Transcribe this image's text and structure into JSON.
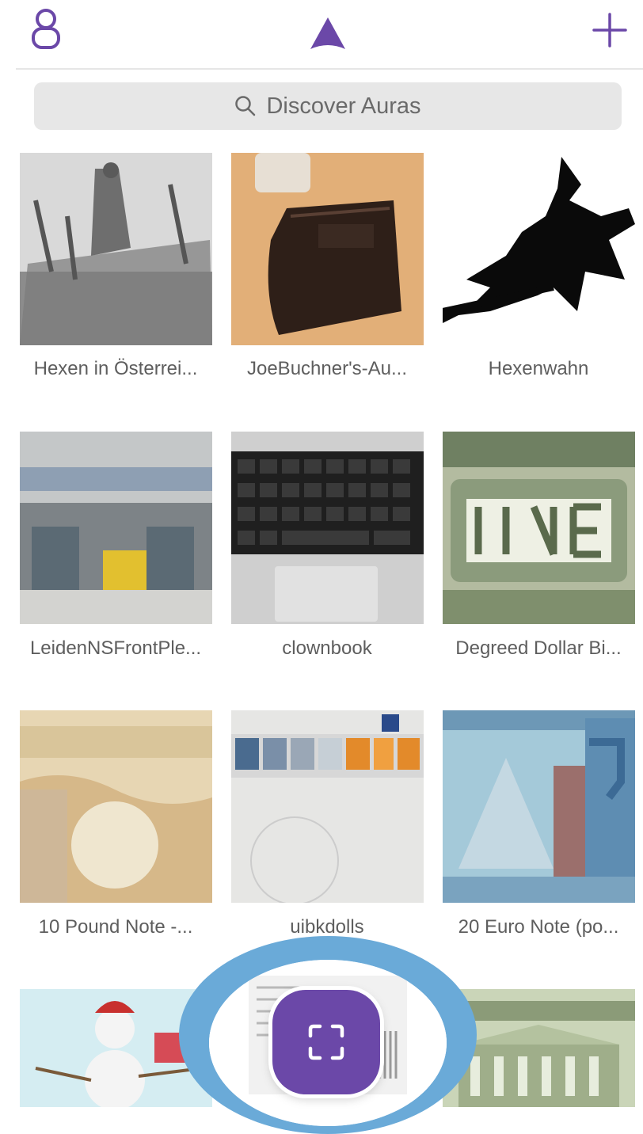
{
  "search": {
    "placeholder": "Discover Auras"
  },
  "colors": {
    "brand_purple": "#6b48a8",
    "scan_halo": "#6aaad8",
    "search_bg": "#e7e7e7"
  },
  "header": {
    "left_icon": "profile-icon",
    "center_icon": "aura-logo-icon",
    "right_icon": "plus-icon"
  },
  "auras": [
    {
      "title": "Hexen in Österrei..."
    },
    {
      "title": "JoeBuchner's-Au..."
    },
    {
      "title": "Hexenwahn"
    },
    {
      "title": "LeidenNSFrontPle..."
    },
    {
      "title": "clownbook"
    },
    {
      "title": "Degreed Dollar Bi..."
    },
    {
      "title": "10 Pound Note -..."
    },
    {
      "title": "uibkdolls"
    },
    {
      "title": "20 Euro Note (po..."
    }
  ],
  "scan_button": {
    "icon": "scan-frame-icon"
  }
}
